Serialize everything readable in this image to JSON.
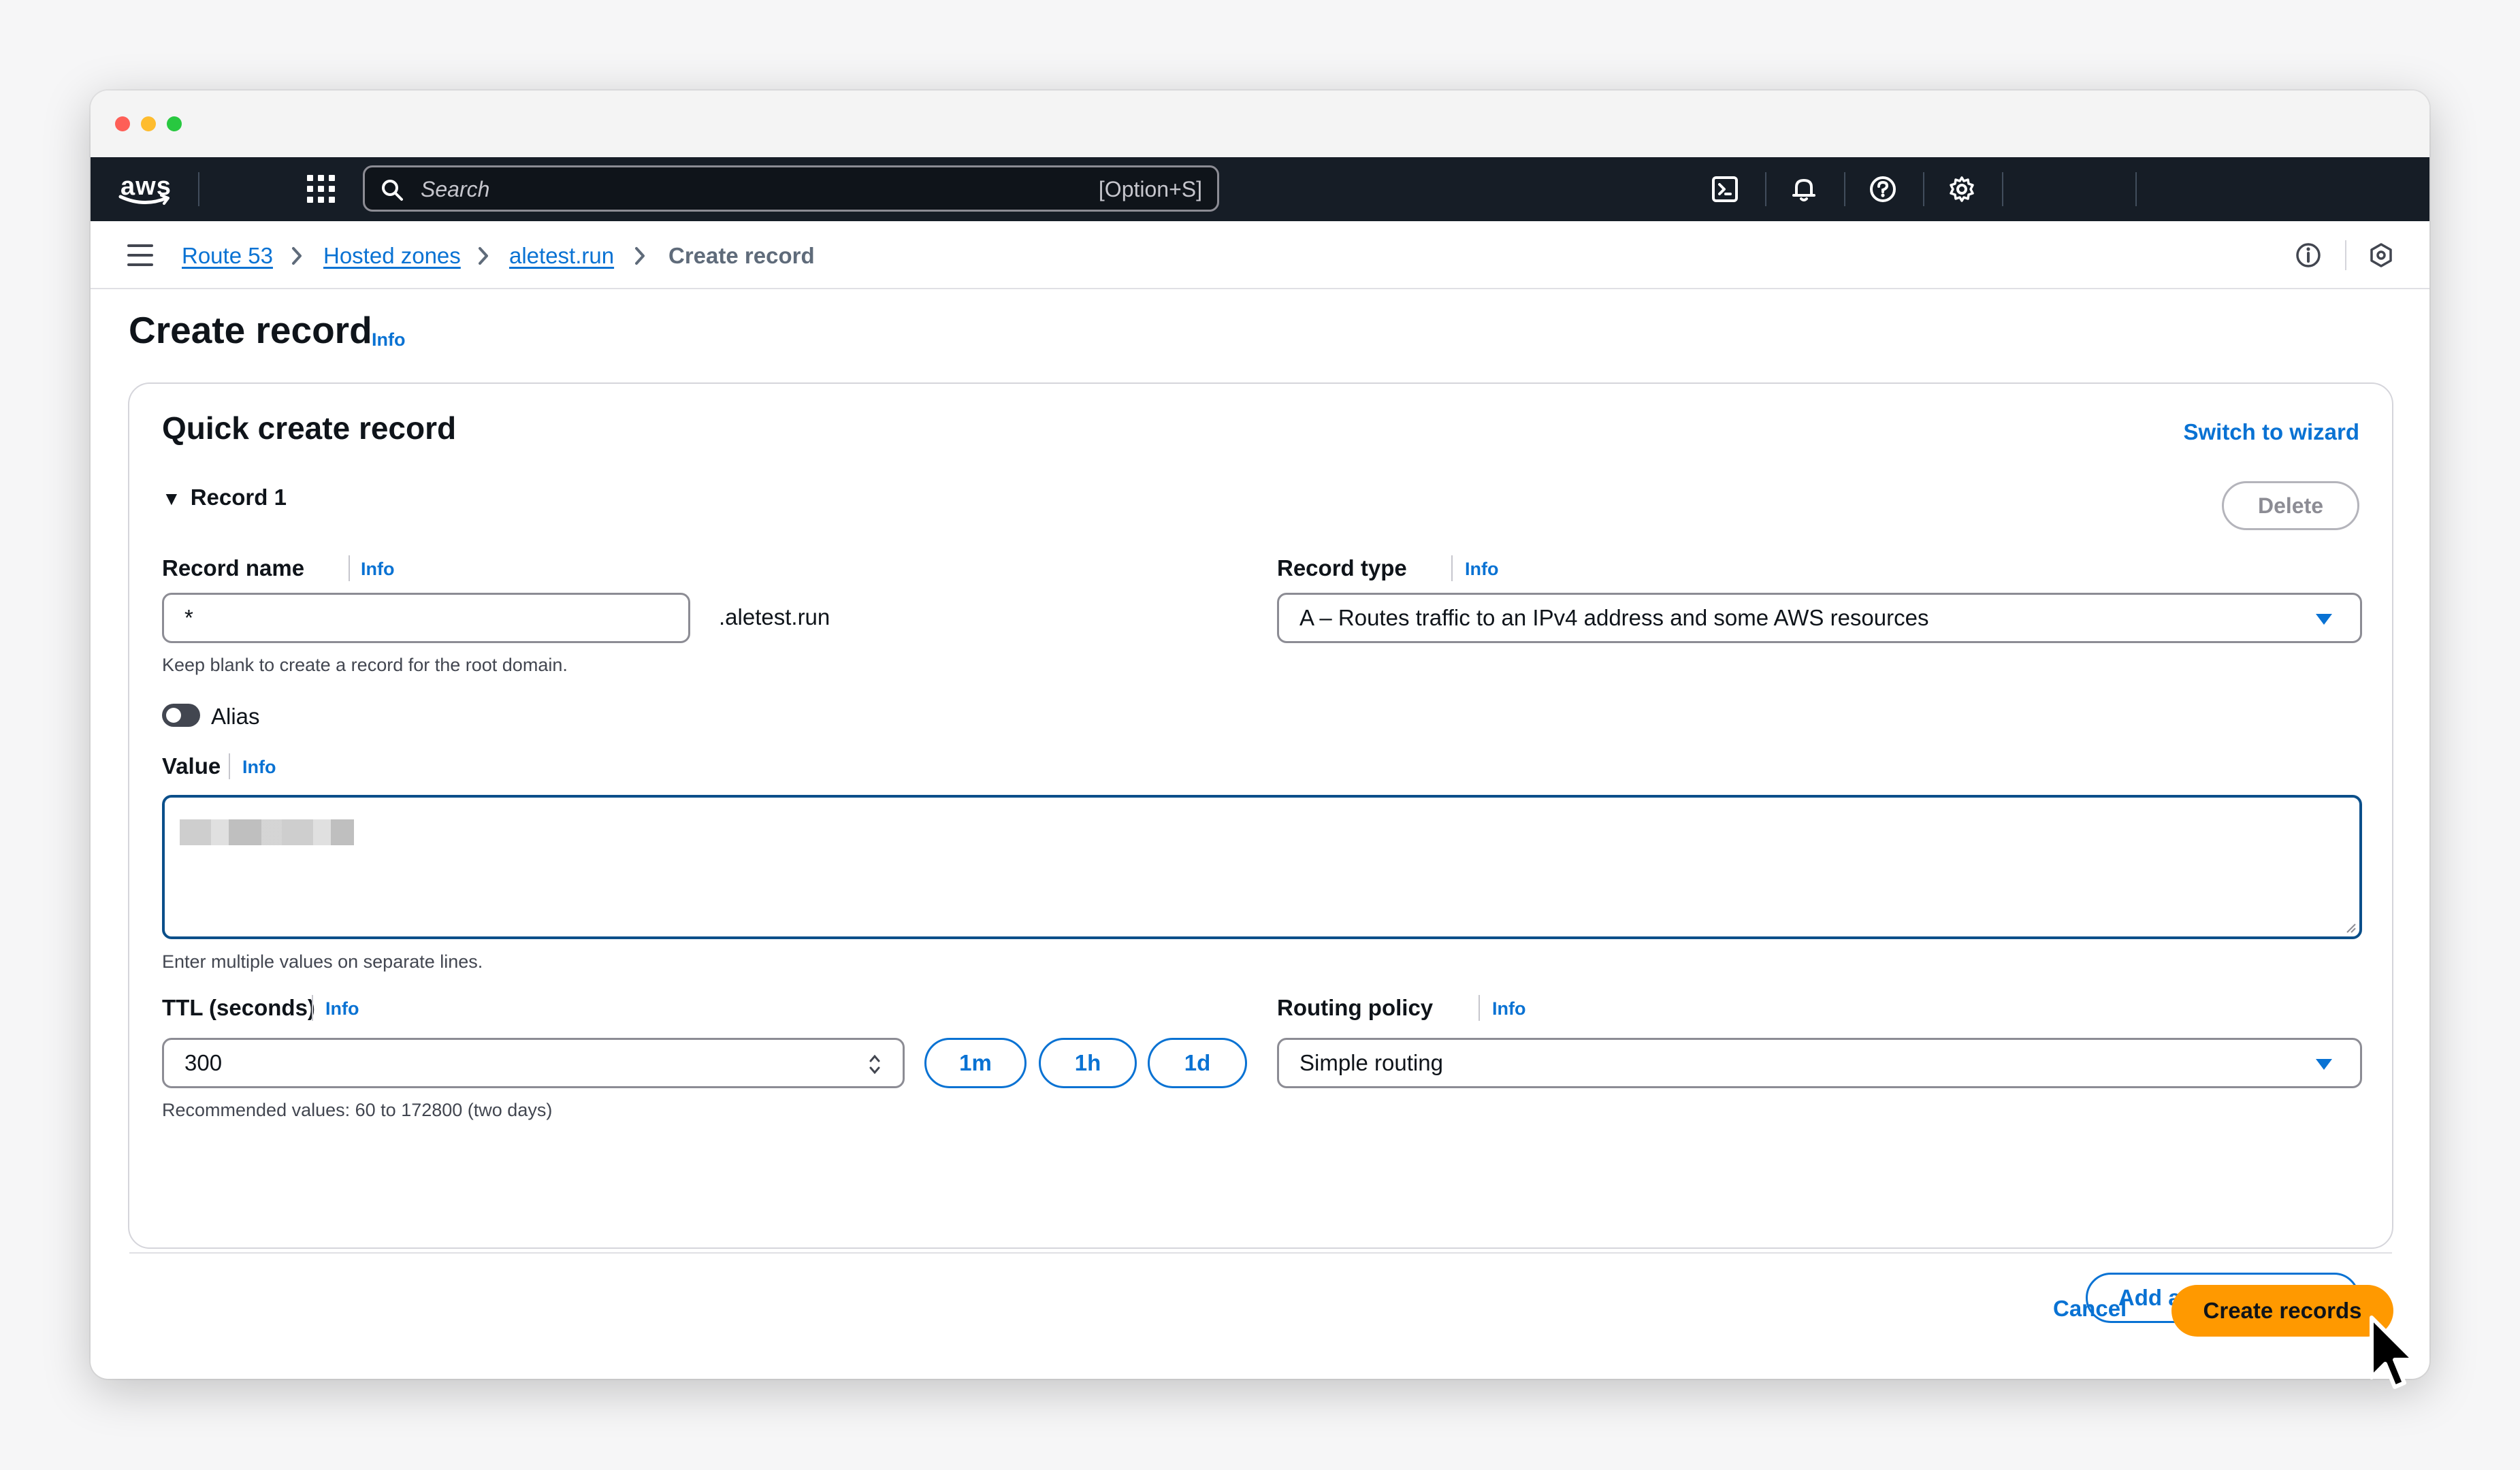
{
  "browser": {
    "traffic_lights": [
      "close",
      "minimize",
      "zoom"
    ]
  },
  "topnav": {
    "logo_text": "aws",
    "search_placeholder": "Search",
    "search_shortcut": "[Option+S]",
    "icons": [
      "cloudshell-icon",
      "bell-icon",
      "help-icon",
      "settings-icon"
    ]
  },
  "breadcrumbs": {
    "items": [
      "Route 53",
      "Hosted zones",
      "aletest.run",
      "Create record"
    ]
  },
  "page": {
    "title": "Create record",
    "title_info": "Info"
  },
  "card": {
    "title": "Quick create record",
    "switch_link": "Switch to wizard",
    "record_toggle": "Record 1",
    "delete_label": "Delete",
    "record_name": {
      "label": "Record name",
      "info": "Info",
      "value": "*",
      "suffix": ".aletest.run",
      "hint": "Keep blank to create a record for the root domain."
    },
    "record_type": {
      "label": "Record type",
      "info": "Info",
      "selected": "A – Routes traffic to an IPv4 address and some AWS resources"
    },
    "alias": {
      "label": "Alias",
      "enabled": false
    },
    "value": {
      "label": "Value",
      "info": "Info",
      "hint": "Enter multiple values on separate lines."
    },
    "ttl": {
      "label": "TTL (seconds)",
      "info": "Info",
      "value": "300",
      "presets": [
        "1m",
        "1h",
        "1d"
      ],
      "hint": "Recommended values: 60 to 172800 (two days)"
    },
    "routing_policy": {
      "label": "Routing policy",
      "info": "Info",
      "selected": "Simple routing"
    },
    "add_record_label": "Add another record"
  },
  "footer": {
    "cancel_label": "Cancel",
    "create_label": "Create records"
  },
  "colors": {
    "link": "#0972d3",
    "primary_button": "#ff9900",
    "nav_bg": "#161d26"
  }
}
